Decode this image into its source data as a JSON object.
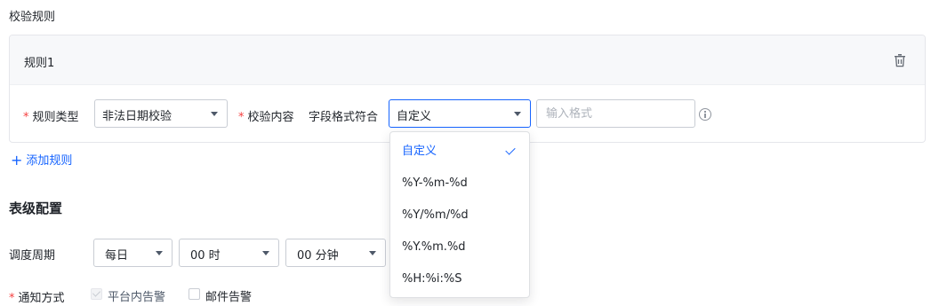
{
  "validation_section": {
    "title": "校验规则"
  },
  "rule": {
    "name": "规则1",
    "rule_type_label": "规则类型",
    "rule_type_value": "非法日期校验",
    "content_label": "校验内容",
    "field_format_label": "字段格式符合",
    "format_select_value": "自定义",
    "format_input_placeholder": "输入格式"
  },
  "add_rule": {
    "label": "添加规则"
  },
  "table_config": {
    "title": "表级配置",
    "schedule_label": "调度周期",
    "schedule_freq": "每日",
    "schedule_hour": "00 时",
    "schedule_minute": "00 分钟",
    "notify_label": "通知方式",
    "notify_platform": "平台内告警",
    "notify_email": "邮件告警"
  },
  "format_dropdown": {
    "options": [
      "自定义",
      "%Y-%m-%d",
      "%Y/%m/%d",
      "%Y.%m.%d",
      "%H:%i:%S"
    ],
    "selected_index": 0
  },
  "required_mark": "*",
  "add_icon": "+",
  "icons": [
    "trash-icon",
    "info-icon",
    "chevron-down-icon",
    "check-icon",
    "plus-icon"
  ],
  "colors": {
    "accent": "#1664ff",
    "required": "#f53f3f",
    "border": "#c9cdd4"
  }
}
